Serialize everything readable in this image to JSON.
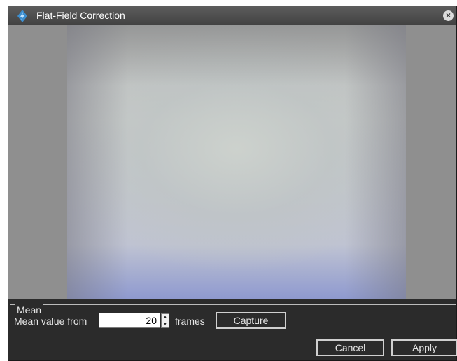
{
  "window": {
    "title": "Flat-Field Correction",
    "close_glyph": "×",
    "icon": "lightning-diamond-icon",
    "accent_color": "#4fa3e0"
  },
  "mean_group": {
    "legend": "Mean",
    "mean_label": "Mean value from",
    "frames_value": "20",
    "frames_label": "frames",
    "capture_label": "Capture"
  },
  "footer": {
    "cancel_label": "Cancel",
    "apply_label": "Apply"
  }
}
